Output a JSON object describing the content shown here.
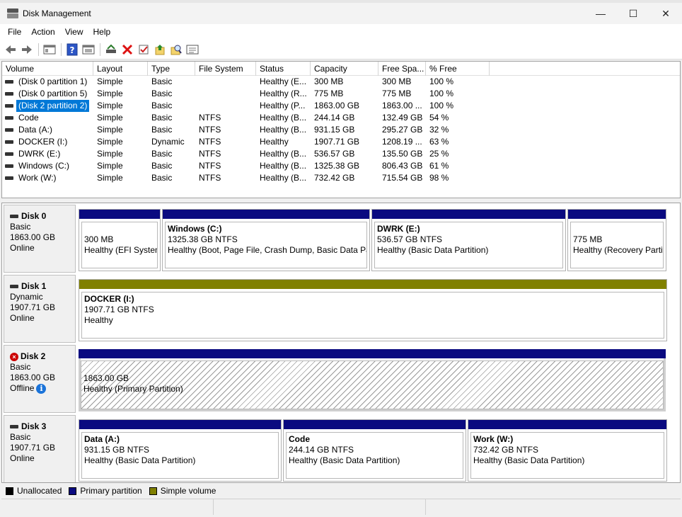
{
  "window": {
    "title": "Disk Management",
    "minimize": "—",
    "maximize": "☐",
    "close": "✕"
  },
  "menu": [
    "File",
    "Action",
    "View",
    "Help"
  ],
  "toolbar_icons": [
    "back-arrow-icon",
    "forward-arrow-icon",
    "console-tree-icon",
    "help-icon",
    "properties-icon",
    "rescan-icon",
    "delete-icon",
    "check-icon",
    "open-icon",
    "explore-icon",
    "properties-list-icon"
  ],
  "columns": [
    "Volume",
    "Layout",
    "Type",
    "File System",
    "Status",
    "Capacity",
    "Free Spa...",
    "% Free"
  ],
  "volumes": [
    {
      "name": "(Disk 0 partition 1)",
      "layout": "Simple",
      "type": "Basic",
      "fs": "",
      "status": "Healthy (E...",
      "capacity": "300 MB",
      "free": "300 MB",
      "pct": "100 %"
    },
    {
      "name": "(Disk 0 partition 5)",
      "layout": "Simple",
      "type": "Basic",
      "fs": "",
      "status": "Healthy (R...",
      "capacity": "775 MB",
      "free": "775 MB",
      "pct": "100 %"
    },
    {
      "name": "(Disk 2 partition 2)",
      "layout": "Simple",
      "type": "Basic",
      "fs": "",
      "status": "Healthy (P...",
      "capacity": "1863.00 GB",
      "free": "1863.00 ...",
      "pct": "100 %",
      "selected": true
    },
    {
      "name": "Code",
      "layout": "Simple",
      "type": "Basic",
      "fs": "NTFS",
      "status": "Healthy (B...",
      "capacity": "244.14 GB",
      "free": "132.49 GB",
      "pct": "54 %"
    },
    {
      "name": "Data (A:)",
      "layout": "Simple",
      "type": "Basic",
      "fs": "NTFS",
      "status": "Healthy (B...",
      "capacity": "931.15 GB",
      "free": "295.27 GB",
      "pct": "32 %"
    },
    {
      "name": "DOCKER (I:)",
      "layout": "Simple",
      "type": "Dynamic",
      "fs": "NTFS",
      "status": "Healthy",
      "capacity": "1907.71 GB",
      "free": "1208.19 ...",
      "pct": "63 %"
    },
    {
      "name": "DWRK (E:)",
      "layout": "Simple",
      "type": "Basic",
      "fs": "NTFS",
      "status": "Healthy (B...",
      "capacity": "536.57 GB",
      "free": "135.50 GB",
      "pct": "25 %"
    },
    {
      "name": "Windows (C:)",
      "layout": "Simple",
      "type": "Basic",
      "fs": "NTFS",
      "status": "Healthy (B...",
      "capacity": "1325.38 GB",
      "free": "806.43 GB",
      "pct": "61 %"
    },
    {
      "name": "Work (W:)",
      "layout": "Simple",
      "type": "Basic",
      "fs": "NTFS",
      "status": "Healthy (B...",
      "capacity": "732.42 GB",
      "free": "715.54 GB",
      "pct": "98 %"
    }
  ],
  "disks": [
    {
      "name": "Disk 0",
      "kind": "Basic",
      "size": "1863.00 GB",
      "state": "Online",
      "partitions": [
        {
          "title": "",
          "size": "300 MB",
          "status": "Healthy (EFI System"
        },
        {
          "title": "Windows  (C:)",
          "size": "1325.38 GB NTFS",
          "status": "Healthy (Boot, Page File, Crash Dump, Basic Data Part"
        },
        {
          "title": "DWRK  (E:)",
          "size": "536.57 GB NTFS",
          "status": "Healthy (Basic Data Partition)"
        },
        {
          "title": "",
          "size": "775 MB",
          "status": "Healthy (Recovery Partiti"
        }
      ]
    },
    {
      "name": "Disk 1",
      "kind": "Dynamic",
      "size": "1907.71 GB",
      "state": "Online",
      "partitions": [
        {
          "title": "DOCKER  (I:)",
          "size": "1907.71 GB NTFS",
          "status": "Healthy"
        }
      ]
    },
    {
      "name": "Disk 2",
      "kind": "Basic",
      "size": "1863.00 GB",
      "state": "Offline",
      "partitions": [
        {
          "title": "",
          "size": "1863.00 GB",
          "status": "Healthy (Primary Partition)"
        }
      ]
    },
    {
      "name": "Disk 3",
      "kind": "Basic",
      "size": "1907.71 GB",
      "state": "Online",
      "partitions": [
        {
          "title": "Data  (A:)",
          "size": "931.15 GB NTFS",
          "status": "Healthy (Basic Data Partition)"
        },
        {
          "title": "Code",
          "size": "244.14 GB NTFS",
          "status": "Healthy (Basic Data Partition)"
        },
        {
          "title": "Work  (W:)",
          "size": "732.42 GB NTFS",
          "status": "Healthy (Basic Data Partition)"
        }
      ]
    }
  ],
  "legend": [
    {
      "label": "Unallocated",
      "color": "#000000"
    },
    {
      "label": "Primary partition",
      "color": "#0a0a80"
    },
    {
      "label": "Simple volume",
      "color": "#808000"
    }
  ]
}
